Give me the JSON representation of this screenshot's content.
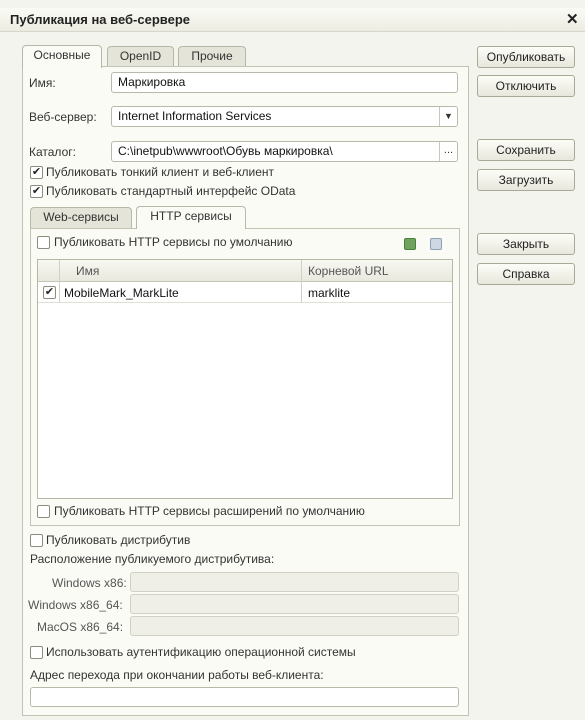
{
  "window": {
    "title": "Публикация на веб-сервере"
  },
  "tabs": [
    {
      "label": "Основные",
      "active": true
    },
    {
      "label": "OpenID",
      "active": false
    },
    {
      "label": "Прочие",
      "active": false
    }
  ],
  "main": {
    "name_label": "Имя:",
    "name_value": "Маркировка",
    "server_label": "Веб-сервер:",
    "server_value": "Internet Information Services",
    "catalog_label": "Каталог:",
    "catalog_value": "C:\\inetpub\\wwwroot\\Обувь маркировка\\",
    "publish_thin_client": {
      "label": "Публиковать тонкий клиент и веб-клиент",
      "checked": true
    },
    "publish_odata": {
      "label": "Публиковать стандартный интерфейс OData",
      "checked": true
    }
  },
  "inner_tabs": [
    {
      "label": "Web-сервисы",
      "active": false
    },
    {
      "label": "HTTP сервисы",
      "active": true
    }
  ],
  "http": {
    "publish_default": {
      "label": "Публиковать HTTP сервисы по умолчанию",
      "checked": false
    },
    "columns": [
      "Имя",
      "Корневой URL"
    ],
    "rows": [
      {
        "checked": true,
        "name": "MobileMark_MarkLite",
        "url": "marklite"
      }
    ],
    "publish_extensions": {
      "label": "Публиковать HTTP сервисы расширений по умолчанию",
      "checked": false
    }
  },
  "distrib": {
    "publish": {
      "label": "Публиковать дистрибутив",
      "checked": false
    },
    "location_label": "Расположение публикуемого дистрибутива:",
    "win86_label": "Windows x86:",
    "win64_label": "Windows x86_64:",
    "mac_label": "MacOS x86_64:",
    "win86_value": "",
    "win64_value": "",
    "mac_value": ""
  },
  "auth": {
    "label": "Использовать аутентификацию операционной системы",
    "checked": false
  },
  "redirect": {
    "label": "Адрес перехода при окончании работы веб-клиента:",
    "value": ""
  },
  "buttons": {
    "publish": "Опубликовать",
    "disable": "Отключить",
    "save": "Сохранить",
    "load": "Загрузить",
    "close": "Закрыть",
    "help": "Справка"
  },
  "icons": {
    "close": "close-icon",
    "check_all": "check-all-icon",
    "uncheck_all": "uncheck-all-icon"
  }
}
